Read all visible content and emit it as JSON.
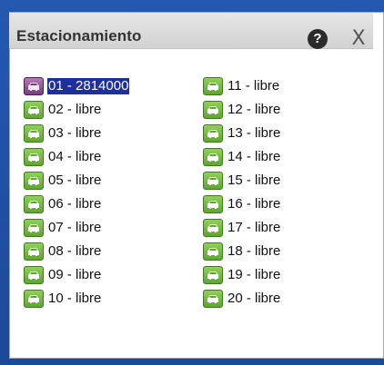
{
  "window": {
    "title": "Estacionamiento",
    "help_label": "?",
    "close_label": "X"
  },
  "colors": {
    "free": "#6bb63a",
    "occupied": "#8a4a92",
    "selection": "#1d2f9c"
  },
  "slots_left": [
    {
      "label": "01 - 2814000",
      "status": "occupied",
      "icon": "car-icon"
    },
    {
      "label": "02 - libre",
      "status": "free",
      "icon": "car-icon"
    },
    {
      "label": "03 - libre",
      "status": "free",
      "icon": "car-icon"
    },
    {
      "label": "04 - libre",
      "status": "free",
      "icon": "car-icon"
    },
    {
      "label": "05 - libre",
      "status": "free",
      "icon": "car-icon"
    },
    {
      "label": "06 - libre",
      "status": "free",
      "icon": "car-icon"
    },
    {
      "label": "07 - libre",
      "status": "free",
      "icon": "car-icon"
    },
    {
      "label": "08 - libre",
      "status": "free",
      "icon": "car-icon"
    },
    {
      "label": "09 - libre",
      "status": "free",
      "icon": "car-icon"
    },
    {
      "label": "10 - libre",
      "status": "free",
      "icon": "car-icon"
    }
  ],
  "slots_right": [
    {
      "label": "11 - libre",
      "status": "free",
      "icon": "car-icon"
    },
    {
      "label": "12 - libre",
      "status": "free",
      "icon": "car-icon"
    },
    {
      "label": "13 - libre",
      "status": "free",
      "icon": "car-icon"
    },
    {
      "label": "14 - libre",
      "status": "free",
      "icon": "car-icon"
    },
    {
      "label": "15 - libre",
      "status": "free",
      "icon": "car-icon"
    },
    {
      "label": "16 - libre",
      "status": "free",
      "icon": "car-icon"
    },
    {
      "label": "17 - libre",
      "status": "free",
      "icon": "car-icon"
    },
    {
      "label": "18 - libre",
      "status": "free",
      "icon": "car-icon"
    },
    {
      "label": "19 - libre",
      "status": "free",
      "icon": "car-icon"
    },
    {
      "label": "20 - libre",
      "status": "free",
      "icon": "car-icon"
    }
  ]
}
